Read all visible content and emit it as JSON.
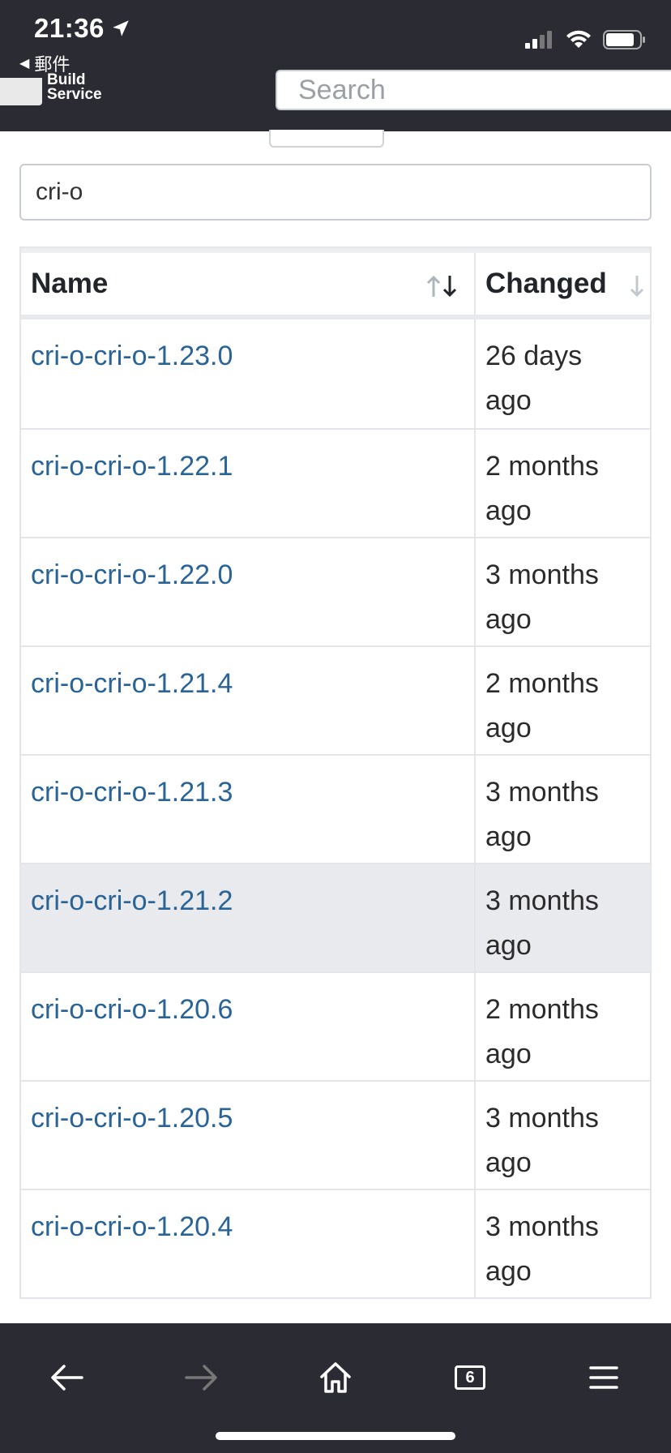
{
  "status_bar": {
    "time": "21:36",
    "back_app": "郵件",
    "icons": [
      "location-arrow-icon",
      "cellular-signal-icon",
      "wifi-icon",
      "battery-icon"
    ]
  },
  "header": {
    "logo_line1": "Build",
    "logo_line2": "Service",
    "search_placeholder": "Search"
  },
  "filter": {
    "value": "cri-o"
  },
  "table": {
    "columns": [
      {
        "label": "Name",
        "sort_icon": "sort-up-down-icon"
      },
      {
        "label": "Changed",
        "sort_icon": "sort-down-icon"
      }
    ],
    "rows": [
      {
        "name": "cri-o-cri-o-1.23.0",
        "changed_line1": "26 days",
        "changed_line2": "ago"
      },
      {
        "name": "cri-o-cri-o-1.22.1",
        "changed_line1": "2 months",
        "changed_line2": "ago"
      },
      {
        "name": "cri-o-cri-o-1.22.0",
        "changed_line1": "3 months",
        "changed_line2": "ago"
      },
      {
        "name": "cri-o-cri-o-1.21.4",
        "changed_line1": "2 months",
        "changed_line2": "ago"
      },
      {
        "name": "cri-o-cri-o-1.21.3",
        "changed_line1": "3 months",
        "changed_line2": "ago"
      },
      {
        "name": "cri-o-cri-o-1.21.2",
        "changed_line1": "3 months",
        "changed_line2": "ago"
      },
      {
        "name": "cri-o-cri-o-1.20.6",
        "changed_line1": "2 months",
        "changed_line2": "ago"
      },
      {
        "name": "cri-o-cri-o-1.20.5",
        "changed_line1": "3 months",
        "changed_line2": "ago"
      },
      {
        "name": "cri-o-cri-o-1.20.4",
        "changed_line1": "3 months",
        "changed_line2": "ago"
      }
    ]
  },
  "toolbar": {
    "tabs_count": "6",
    "icons": [
      "back-arrow-icon",
      "forward-arrow-icon",
      "home-icon",
      "tabs-icon",
      "menu-icon"
    ]
  },
  "colors": {
    "chrome_bg": "#2b2c33",
    "link": "#2a6496",
    "row_highlight": "#e9eaed"
  }
}
